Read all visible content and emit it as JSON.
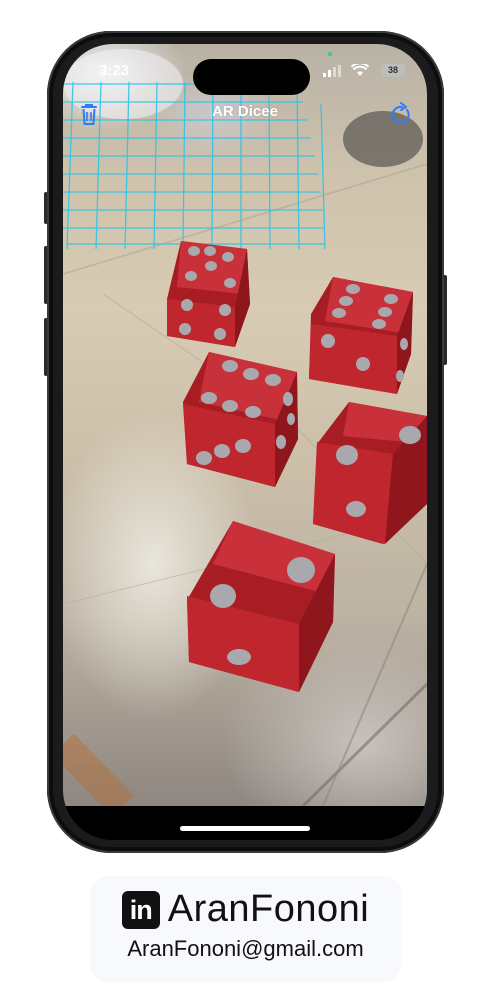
{
  "status_bar": {
    "time": "3:23",
    "battery": "38"
  },
  "nav": {
    "title": "AR Dicee",
    "left_icon": "trash-icon",
    "right_icon": "refresh-icon"
  },
  "scene": {
    "plane_grid_color": "#2ec4e6",
    "die_color": "#c0262d",
    "pip_color": "#a9a9ad",
    "dice_count": 5
  },
  "badge": {
    "logo": "in",
    "name": "AranFononi",
    "email": "AranFononi@gmail.com"
  }
}
